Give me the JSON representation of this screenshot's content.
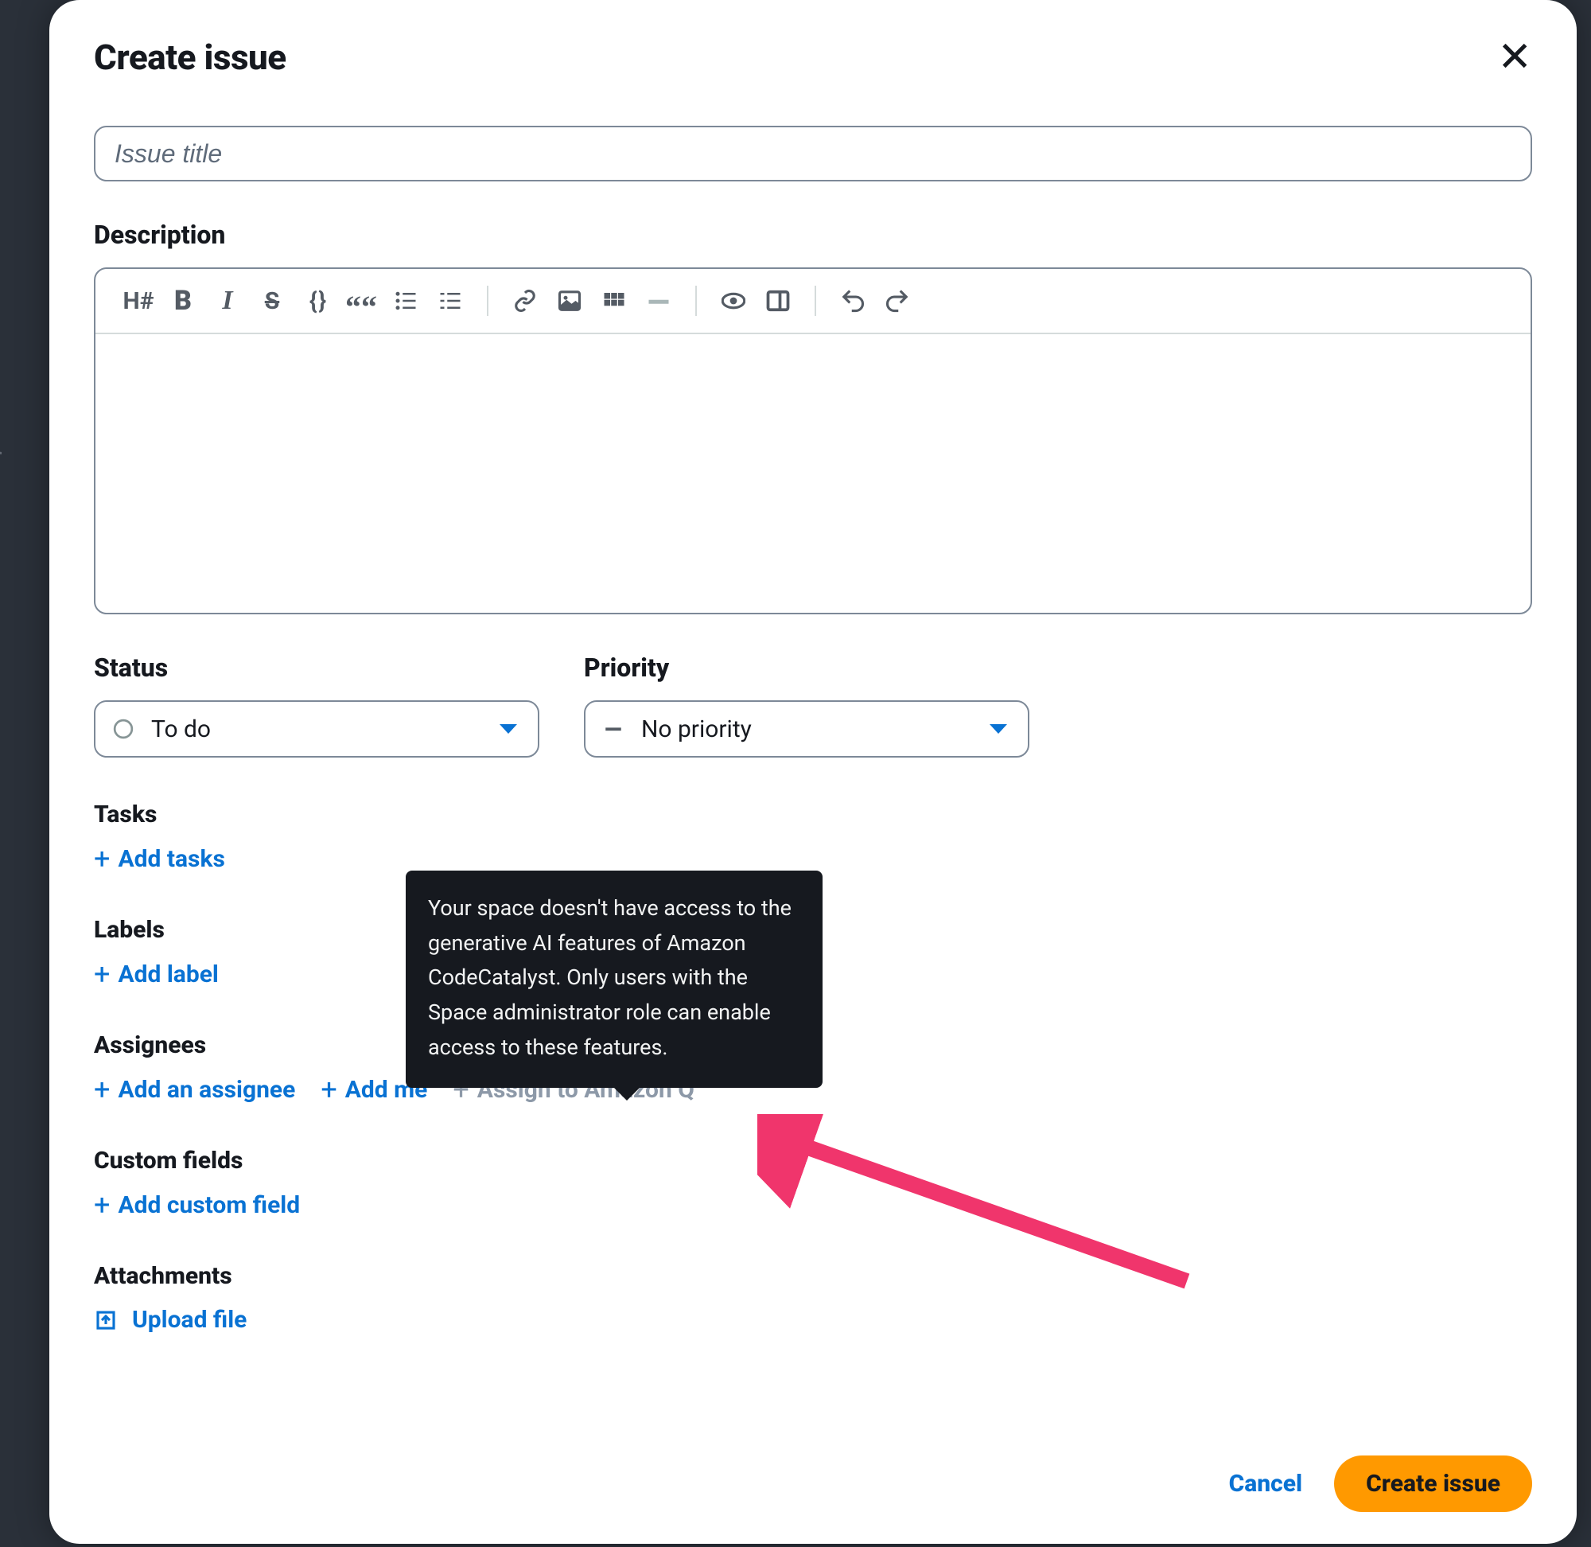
{
  "modal": {
    "title": "Create issue",
    "titleInput": {
      "placeholder": "Issue title",
      "value": ""
    },
    "descriptionLabel": "Description"
  },
  "toolbar": {
    "heading": "H#",
    "bold": "B",
    "italic": "I",
    "strike": "S",
    "code": "{ }",
    "quote": "““"
  },
  "status": {
    "label": "Status",
    "value": "To do"
  },
  "priority": {
    "label": "Priority",
    "value": "No priority"
  },
  "sections": {
    "tasksLabel": "Tasks",
    "addTasks": "Add tasks",
    "labelsLabel": "Labels",
    "addLabel": "Add label",
    "assigneesLabel": "Assignees",
    "addAssignee": "Add an assignee",
    "addMe": "Add me",
    "assignQ": "Assign to Amazon Q",
    "customFieldsLabel": "Custom fields",
    "addCustomField": "Add custom field",
    "attachmentsLabel": "Attachments",
    "uploadFile": "Upload file"
  },
  "tooltip": "Your space doesn't have access to the generative AI features of Amazon CodeCatalyst. Only users with the Space administrator role can enable access to these features.",
  "footer": {
    "cancel": "Cancel",
    "create": "Create issue"
  },
  "colors": {
    "link": "#0972d3",
    "primaryBg": "#ff9900",
    "tooltipBg": "#16191f",
    "arrow": "#f0356c"
  }
}
